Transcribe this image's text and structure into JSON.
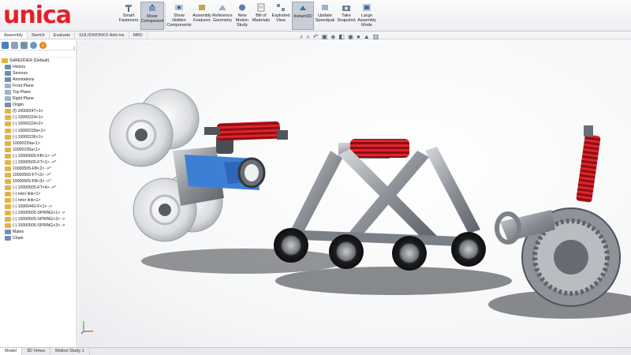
{
  "logo": {
    "text": "unica"
  },
  "ribbon": {
    "buttons": [
      {
        "label": "Smart Fasteners"
      },
      {
        "label": "Move Component"
      },
      {
        "label": "Show Hidden Components"
      },
      {
        "label": "Assembly Features"
      },
      {
        "label": "Reference Geometry"
      },
      {
        "label": "New Motion Study"
      },
      {
        "label": "Bill of Materials"
      },
      {
        "label": "Exploded View"
      },
      {
        "label": "Instant3D"
      },
      {
        "label": "Update Speedpak"
      },
      {
        "label": "Take Snapshot"
      },
      {
        "label": "Large Assembly Mode"
      }
    ]
  },
  "tabs": [
    "Assembly",
    "Sketch",
    "Evaluate",
    "SOLIDWORKS Add-Ins",
    "MBD"
  ],
  "tree": {
    "root": "SHREDDER (Default)",
    "items": [
      "History",
      "Sensors",
      "Annotations",
      "Front Plane",
      "Top Plane",
      "Right Plane",
      "Origin",
      "(f) 1000024T<1>",
      "(-) 10000224<1>",
      "(-) 10000224<2>",
      "(-) 10000239a<1>",
      "(-) 10000236<1>",
      "10000239a<1>",
      "10000236a<1>",
      "(-) 10000505-FB<1> ->*",
      "(-) 10000505-FT<1> ->*",
      "10000505-FB<2> ->*",
      "10000505-FT<3> ->*",
      "10000505-FB<3> ->*",
      "(-) 10000505-FT<4> ->*",
      "(-) rotor link<1>",
      "(-) rotor link<1>",
      "(-) 10000442-F<1> ->",
      "(-) 10000505-SPRING<1> ->",
      "(-) 10000505-SPRING<2> ->",
      "(-) 10000505-SPRING<3> ->",
      "Mates",
      "Chain"
    ]
  },
  "status": [
    "Model",
    "3D Views",
    "Motion Study 1"
  ]
}
